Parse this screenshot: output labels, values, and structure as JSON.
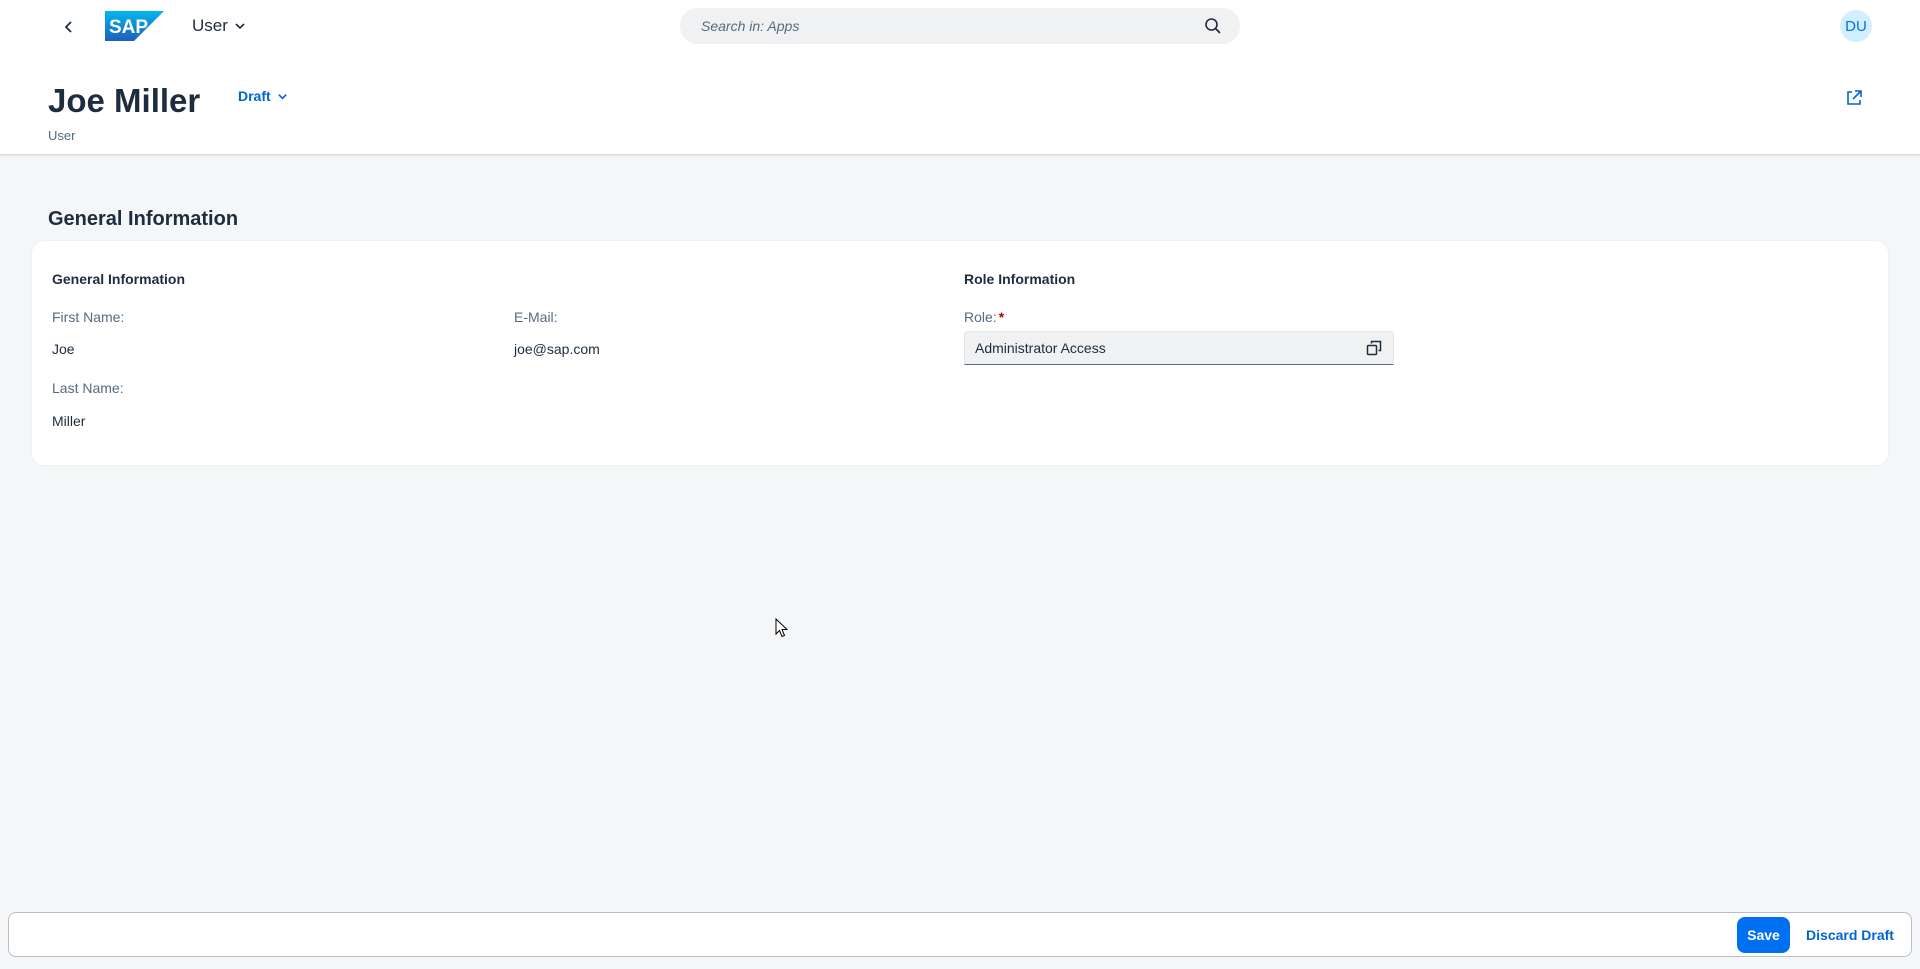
{
  "shellbar": {
    "back_icon": "chevron-left-icon",
    "logo_text": "SAP",
    "app_title": "User",
    "search": {
      "placeholder": "Search in: Apps",
      "value": ""
    },
    "avatar_initials": "DU"
  },
  "header": {
    "title": "Joe Miller",
    "subtitle": "User",
    "draft_label": "Draft",
    "share_icon": "share-icon"
  },
  "section": {
    "title": "General Information",
    "groups": {
      "general": {
        "title": "General Information",
        "first_name_label": "First Name:",
        "first_name": "Joe",
        "last_name_label": "Last Name:",
        "last_name": "Miller",
        "email_label": "E-Mail:",
        "email": "joe@sap.com"
      },
      "role": {
        "title": "Role Information",
        "role_label": "Role:",
        "required_mark": "*",
        "role_value": "Administrator Access"
      }
    }
  },
  "footer": {
    "save_label": "Save",
    "discard_label": "Discard Draft"
  },
  "colors": {
    "brand": "#0070f2",
    "link": "#0064d9",
    "background": "#f5f6f7",
    "text": "#1d2d3e",
    "label": "#556b82",
    "required": "#aa0808"
  }
}
